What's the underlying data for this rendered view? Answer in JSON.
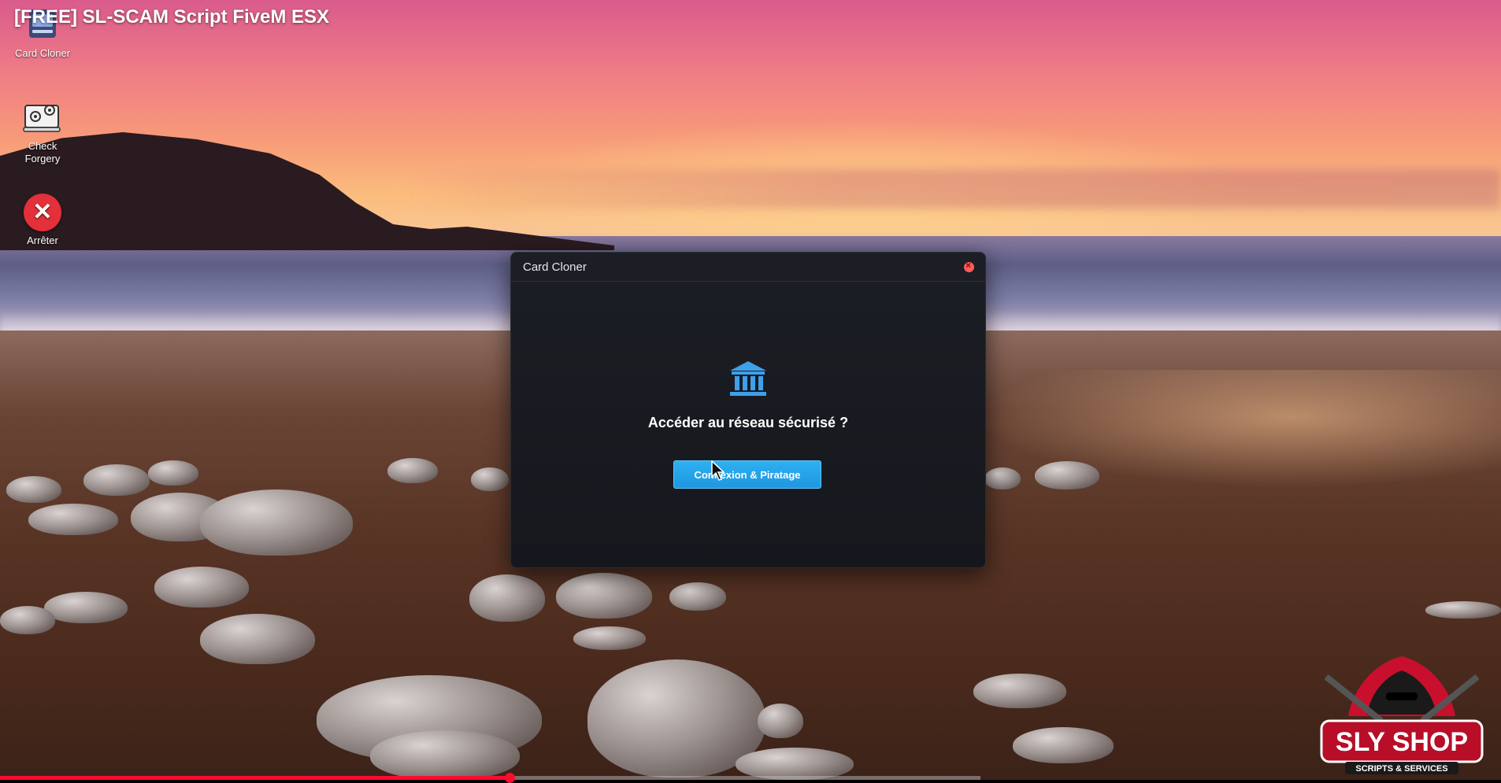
{
  "video": {
    "title": "[FREE] SL-SCAM Script FiveM ESX",
    "progress_percent": 52
  },
  "desktop": {
    "icons": [
      {
        "label": "Card Cloner",
        "icon": "card-cloner-icon"
      },
      {
        "label": "Check\nForgery",
        "icon": "check-forgery-icon"
      },
      {
        "label": "Arrêter",
        "icon": "stop-icon"
      }
    ]
  },
  "window": {
    "title": "Card Cloner",
    "icon": "bank-icon",
    "prompt": "Accéder au réseau sécurisé ?",
    "button_label": "Connexion & Piratage"
  },
  "watermark": {
    "brand": "SLY SHOP",
    "tagline": "SCRIPTS & SERVICES"
  },
  "colors": {
    "accent": "#1e97e0",
    "close": "#ff5a5a",
    "stop": "#e3303a",
    "progress": "#ff0b2e"
  }
}
